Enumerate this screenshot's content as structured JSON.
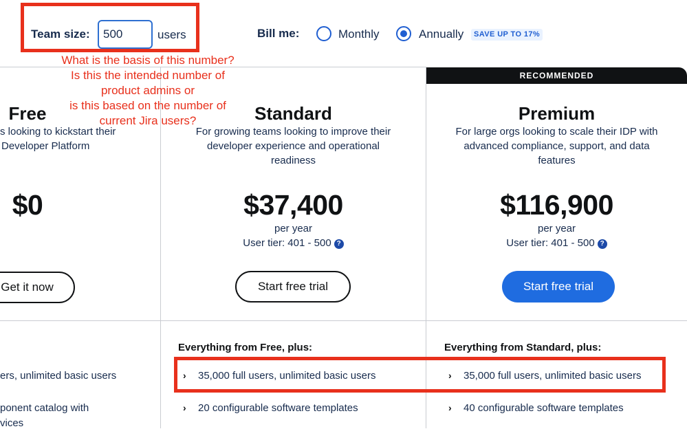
{
  "team_size": {
    "label": "Team size:",
    "value": "500",
    "unit": "users"
  },
  "billing": {
    "label": "Bill me:",
    "options": [
      {
        "label": "Monthly",
        "selected": false
      },
      {
        "label": "Annually",
        "selected": true
      }
    ],
    "save_badge": "SAVE UP TO 17%"
  },
  "annotation": "What is the basis of this number?\nIs this the intended number of\nproduct admins or\nis this based on the number of\ncurrent Jira users?",
  "recommended_label": "RECOMMENDED",
  "plans": [
    {
      "name": "Free",
      "desc_lines": [
        "s looking to kickstart their",
        "Developer Platform"
      ],
      "price": "$0",
      "cta": "Get it now",
      "features": [
        "ers, unlimited basic users",
        "ponent catalog with",
        "vices"
      ]
    },
    {
      "name": "Standard",
      "desc_lines": [
        "For growing teams looking to improve their",
        "developer experience and operational",
        "readiness"
      ],
      "price": "$37,400",
      "period": "per year",
      "tier": "User tier: 401 - 500",
      "cta": "Start free trial",
      "features_heading": "Everything from Free, plus:",
      "features": [
        "35,000 full users, unlimited basic users",
        "20 configurable software templates"
      ]
    },
    {
      "name": "Premium",
      "desc_lines": [
        "For large orgs looking to scale their IDP with",
        "advanced compliance, support, and data",
        "features"
      ],
      "price": "$116,900",
      "period": "per year",
      "tier": "User tier: 401 - 500",
      "cta": "Start free trial",
      "features_heading": "Everything from Standard, plus:",
      "features": [
        "35,000 full users, unlimited basic users",
        "40 configurable software templates"
      ]
    }
  ],
  "colors": {
    "accent": "#1f6ce0",
    "annotation_red": "#e8301c",
    "recommended_bg": "#101214"
  },
  "icons": {
    "help": "question-circle-icon",
    "chevron": "chevron-right-icon"
  }
}
